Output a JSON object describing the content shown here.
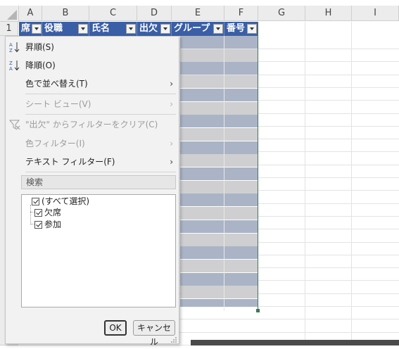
{
  "columns": [
    "A",
    "B",
    "C",
    "D",
    "E",
    "F",
    "G",
    "H",
    "I"
  ],
  "row_number": "1",
  "table_headers": [
    "席",
    "役職",
    "氏名",
    "出欠",
    "グループ",
    "番号"
  ],
  "menu": {
    "sort_asc": "昇順(S)",
    "sort_desc": "降順(O)",
    "sort_by_color": "色で並べ替え(T)",
    "sheet_view": "シート ビュー(V)",
    "clear_filter": "\"出欠\" からフィルターをクリア(C)",
    "color_filter": "色フィルター(I)",
    "text_filter": "テキスト フィルター(F)",
    "search_placeholder": "検索",
    "list": [
      {
        "label": "(すべて選択)",
        "checked": true
      },
      {
        "label": "欠席",
        "checked": true
      },
      {
        "label": "参加",
        "checked": true
      }
    ],
    "ok": "OK",
    "cancel": "キャンセル",
    "submenu_arrow": "›"
  },
  "colors": {
    "header_blue": "#3a5fa6",
    "band_dark": "#aab4c6",
    "band_light": "#cfcfd1",
    "selection_green": "#3a7a55"
  }
}
